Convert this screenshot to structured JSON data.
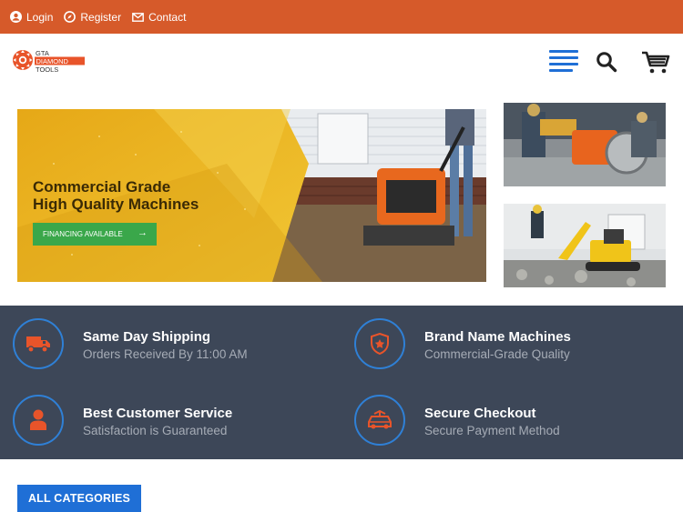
{
  "topbar": {
    "login": "Login",
    "register": "Register",
    "contact": "Contact"
  },
  "logo": {
    "line1": "GTA",
    "line2": "DIAMOND",
    "line3": "TOOLS"
  },
  "hero": {
    "title_line1": "Commercial Grade",
    "title_line2": "High Quality Machines",
    "button_label": "FINANCING AVAILABLE",
    "button_arrow": "→"
  },
  "features": [
    {
      "title": "Same Day Shipping",
      "subtitle": "Orders Received By 11:00 AM",
      "icon": "truck-icon"
    },
    {
      "title": "Brand Name Machines",
      "subtitle": "Commercial-Grade Quality",
      "icon": "badge-icon"
    },
    {
      "title": "Best Customer Service",
      "subtitle": "Satisfaction is Guaranteed",
      "icon": "user-icon"
    },
    {
      "title": "Secure Checkout",
      "subtitle": "Secure Payment Method",
      "icon": "car-icon"
    }
  ],
  "category_button": "ALL CATEGORIES",
  "colors": {
    "topbar": "#d65a2a",
    "accent_blue": "#1f6fd6",
    "feature_band": "#3d4758",
    "hero_yellow": "#e7b21f",
    "button_green": "#3aa74a",
    "icon_orange": "#e8542a"
  }
}
